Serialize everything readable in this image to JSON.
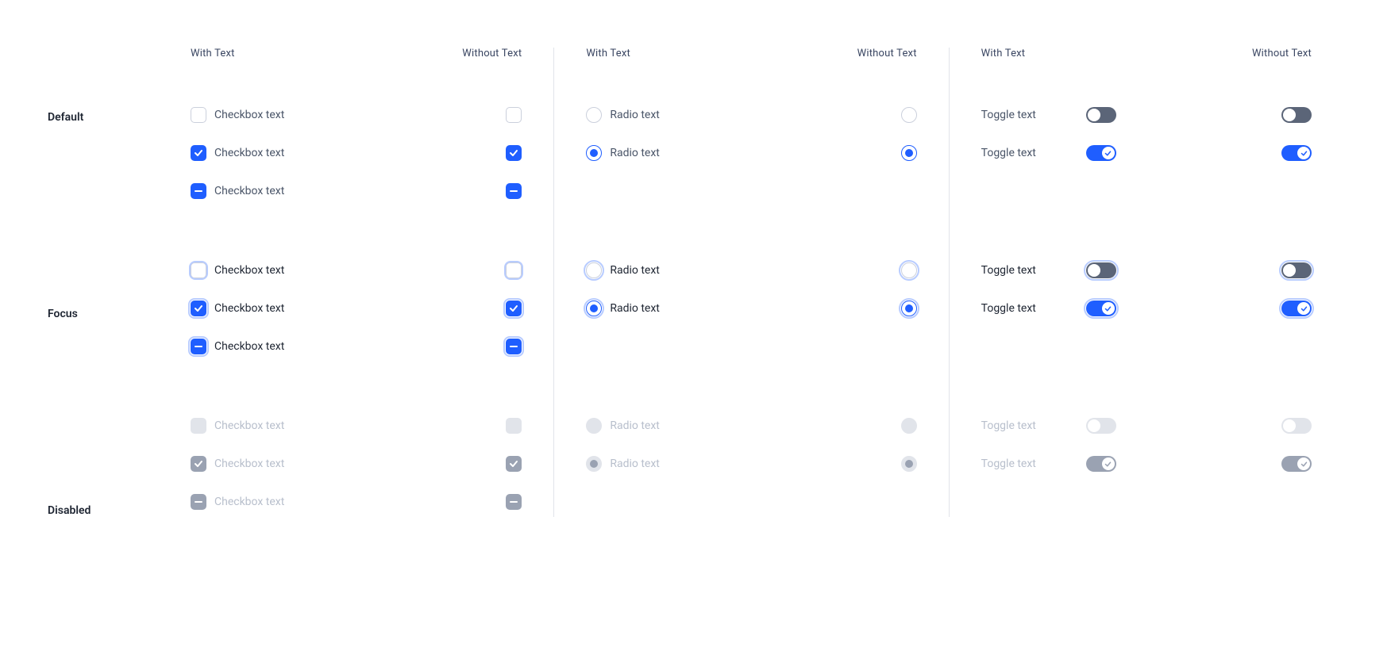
{
  "columnHeaders": {
    "withText": "With Text",
    "withoutText": "Without Text"
  },
  "rowLabels": {
    "default": "Default",
    "focus": "Focus",
    "disabled": "Disabled"
  },
  "labels": {
    "checkbox": "Checkbox text",
    "radio": "Radio text",
    "toggle": "Toggle text"
  }
}
